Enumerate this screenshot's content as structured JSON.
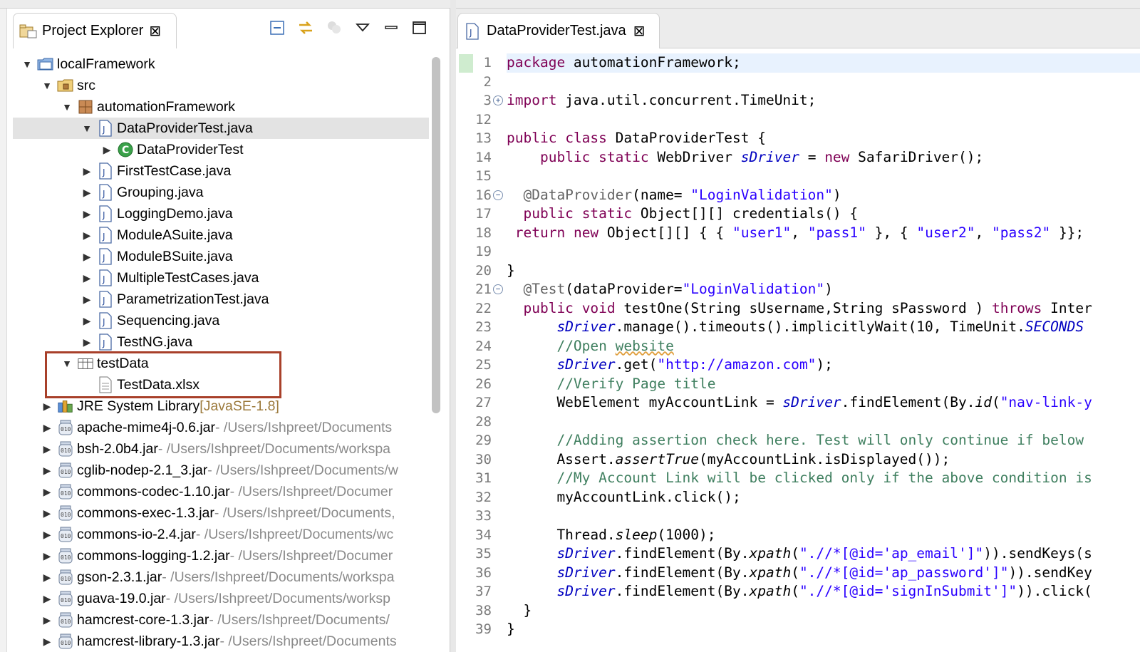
{
  "explorer": {
    "title": "Project Explorer",
    "close_glyph": "⊠",
    "tree": [
      {
        "label": "localFramework",
        "icon": "project-folder-icon",
        "level": 0,
        "expanded": true
      },
      {
        "label": "src",
        "icon": "source-folder-icon",
        "level": 1,
        "expanded": true
      },
      {
        "label": "automationFramework",
        "icon": "package-icon",
        "level": 2,
        "expanded": true
      },
      {
        "label": "DataProviderTest.java",
        "icon": "java-file-icon",
        "level": 3,
        "expanded": true,
        "selected": true
      },
      {
        "label": "DataProviderTest",
        "icon": "class-icon",
        "level": 4,
        "expanded": false
      },
      {
        "label": "FirstTestCase.java",
        "icon": "java-file-icon",
        "level": 3,
        "expanded": false
      },
      {
        "label": "Grouping.java",
        "icon": "java-file-icon",
        "level": 3,
        "expanded": false
      },
      {
        "label": "LoggingDemo.java",
        "icon": "java-file-icon",
        "level": 3,
        "expanded": false
      },
      {
        "label": "ModuleASuite.java",
        "icon": "java-file-icon",
        "level": 3,
        "expanded": false
      },
      {
        "label": "ModuleBSuite.java",
        "icon": "java-file-icon",
        "level": 3,
        "expanded": false
      },
      {
        "label": "MultipleTestCases.java",
        "icon": "java-file-icon",
        "level": 3,
        "expanded": false
      },
      {
        "label": "ParametrizationTest.java",
        "icon": "java-file-icon",
        "level": 3,
        "expanded": false
      },
      {
        "label": "Sequencing.java",
        "icon": "java-file-icon",
        "level": 3,
        "expanded": false
      },
      {
        "label": "TestNG.java",
        "icon": "java-file-icon",
        "level": 3,
        "expanded": false
      },
      {
        "label": "testData",
        "icon": "folder-icon",
        "level": 2,
        "expanded": true
      },
      {
        "label": "TestData.xlsx",
        "icon": "file-icon",
        "level": 3,
        "leaf": true
      },
      {
        "label": "JRE System Library",
        "tag": "[JavaSE-1.8]",
        "icon": "library-icon",
        "level": 1,
        "expanded": false
      },
      {
        "label": "apache-mime4j-0.6.jar",
        "path": " - /Users/Ishpreet/Documents",
        "icon": "jar-icon",
        "level": 1,
        "expanded": false
      },
      {
        "label": "bsh-2.0b4.jar",
        "path": " - /Users/Ishpreet/Documents/workspa",
        "icon": "jar-icon",
        "level": 1,
        "expanded": false
      },
      {
        "label": "cglib-nodep-2.1_3.jar",
        "path": " - /Users/Ishpreet/Documents/w",
        "icon": "jar-icon",
        "level": 1,
        "expanded": false
      },
      {
        "label": "commons-codec-1.10.jar",
        "path": " - /Users/Ishpreet/Documer",
        "icon": "jar-icon",
        "level": 1,
        "expanded": false
      },
      {
        "label": "commons-exec-1.3.jar",
        "path": " - /Users/Ishpreet/Documents,",
        "icon": "jar-icon",
        "level": 1,
        "expanded": false
      },
      {
        "label": "commons-io-2.4.jar",
        "path": " - /Users/Ishpreet/Documents/wc",
        "icon": "jar-icon",
        "level": 1,
        "expanded": false
      },
      {
        "label": "commons-logging-1.2.jar",
        "path": " - /Users/Ishpreet/Documer",
        "icon": "jar-icon",
        "level": 1,
        "expanded": false
      },
      {
        "label": "gson-2.3.1.jar",
        "path": " - /Users/Ishpreet/Documents/workspa",
        "icon": "jar-icon",
        "level": 1,
        "expanded": false
      },
      {
        "label": "guava-19.0.jar",
        "path": " - /Users/Ishpreet/Documents/worksp",
        "icon": "jar-icon",
        "level": 1,
        "expanded": false
      },
      {
        "label": "hamcrest-core-1.3.jar",
        "path": " - /Users/Ishpreet/Documents/",
        "icon": "jar-icon",
        "level": 1,
        "expanded": false
      },
      {
        "label": "hamcrest-library-1.3.jar",
        "path": " - /Users/Ishpreet/Documents",
        "icon": "jar-icon",
        "level": 1,
        "expanded": false
      }
    ]
  },
  "editor": {
    "tab_title": "DataProviderTest.java",
    "close_glyph": "⊠",
    "lines": [
      {
        "n": "1",
        "fold": "",
        "current": true,
        "tokens": [
          [
            "kw",
            "package"
          ],
          [
            "",
            " automationFramework;"
          ]
        ]
      },
      {
        "n": "2",
        "fold": "",
        "tokens": []
      },
      {
        "n": "3",
        "fold": "+",
        "tokens": [
          [
            "kw",
            "import"
          ],
          [
            "",
            " java.util.concurrent.TimeUnit;"
          ]
        ]
      },
      {
        "n": "12",
        "fold": "",
        "tokens": []
      },
      {
        "n": "13",
        "fold": "",
        "tokens": [
          [
            "kw",
            "public"
          ],
          [
            "",
            " "
          ],
          [
            "kw",
            "class"
          ],
          [
            "",
            " DataProviderTest {"
          ]
        ]
      },
      {
        "n": "14",
        "fold": "",
        "tokens": [
          [
            "",
            "    "
          ],
          [
            "kw",
            "public"
          ],
          [
            "",
            " "
          ],
          [
            "kw",
            "static"
          ],
          [
            "",
            " WebDriver "
          ],
          [
            "fld",
            "sDriver"
          ],
          [
            "",
            " = "
          ],
          [
            "kw",
            "new"
          ],
          [
            "",
            " SafariDriver();"
          ]
        ]
      },
      {
        "n": "15",
        "fold": "",
        "tokens": []
      },
      {
        "n": "16",
        "fold": "−",
        "tokens": [
          [
            "",
            "  "
          ],
          [
            "ann",
            "@DataProvider"
          ],
          [
            "",
            "(name= "
          ],
          [
            "st",
            "\"LoginValidation\""
          ],
          [
            "",
            ")"
          ]
        ]
      },
      {
        "n": "17",
        "fold": "",
        "tokens": [
          [
            "",
            "  "
          ],
          [
            "kw",
            "public"
          ],
          [
            "",
            " "
          ],
          [
            "kw",
            "static"
          ],
          [
            "",
            " Object[][] credentials() {"
          ]
        ]
      },
      {
        "n": "18",
        "fold": "",
        "tokens": [
          [
            "",
            " "
          ],
          [
            "kw",
            "return"
          ],
          [
            "",
            " "
          ],
          [
            "kw",
            "new"
          ],
          [
            "",
            " Object[][] { { "
          ],
          [
            "st",
            "\"user1\""
          ],
          [
            "",
            ", "
          ],
          [
            "st",
            "\"pass1\""
          ],
          [
            "",
            " }, { "
          ],
          [
            "st",
            "\"user2\""
          ],
          [
            "",
            ", "
          ],
          [
            "st",
            "\"pass2\""
          ],
          [
            "",
            " }};"
          ]
        ]
      },
      {
        "n": "19",
        "fold": "",
        "tokens": []
      },
      {
        "n": "20",
        "fold": "",
        "tokens": [
          [
            "",
            "}"
          ]
        ]
      },
      {
        "n": "21",
        "fold": "−",
        "tokens": [
          [
            "",
            "  "
          ],
          [
            "ann",
            "@Test"
          ],
          [
            "",
            "(dataProvider="
          ],
          [
            "st",
            "\"LoginValidation\""
          ],
          [
            "",
            ")"
          ]
        ]
      },
      {
        "n": "22",
        "fold": "",
        "tokens": [
          [
            "",
            "  "
          ],
          [
            "kw",
            "public"
          ],
          [
            "",
            " "
          ],
          [
            "kw",
            "void"
          ],
          [
            "",
            " testOne(String sUsername,String sPassword ) "
          ],
          [
            "kw",
            "throws"
          ],
          [
            "",
            " Inter"
          ]
        ]
      },
      {
        "n": "23",
        "fold": "",
        "tokens": [
          [
            "",
            "      "
          ],
          [
            "fld",
            "sDriver"
          ],
          [
            "",
            ".manage().timeouts().implicitlyWait(10, TimeUnit."
          ],
          [
            "fld",
            "SECONDS"
          ]
        ]
      },
      {
        "n": "24",
        "fold": "",
        "tokens": [
          [
            "",
            "      "
          ],
          [
            "cm",
            "//Open "
          ],
          [
            "cmsq",
            "website"
          ]
        ]
      },
      {
        "n": "25",
        "fold": "",
        "tokens": [
          [
            "",
            "      "
          ],
          [
            "fld",
            "sDriver"
          ],
          [
            "",
            ".get("
          ],
          [
            "st",
            "\"http://amazon.com\""
          ],
          [
            "",
            ");"
          ]
        ]
      },
      {
        "n": "26",
        "fold": "",
        "tokens": [
          [
            "",
            "      "
          ],
          [
            "cm",
            "//Verify Page title"
          ]
        ]
      },
      {
        "n": "27",
        "fold": "",
        "tokens": [
          [
            "",
            "      WebElement myAccountLink = "
          ],
          [
            "fld",
            "sDriver"
          ],
          [
            "",
            ".findElement(By."
          ],
          [
            "it",
            "id"
          ],
          [
            "",
            "("
          ],
          [
            "st",
            "\"nav-link-y"
          ]
        ]
      },
      {
        "n": "28",
        "fold": "",
        "tokens": []
      },
      {
        "n": "29",
        "fold": "",
        "tokens": [
          [
            "",
            "      "
          ],
          [
            "cm",
            "//Adding assertion check here. Test will only continue if below"
          ]
        ]
      },
      {
        "n": "30",
        "fold": "",
        "tokens": [
          [
            "",
            "      Assert."
          ],
          [
            "it",
            "assertTrue"
          ],
          [
            "",
            "(myAccountLink.isDisplayed());"
          ]
        ]
      },
      {
        "n": "31",
        "fold": "",
        "tokens": [
          [
            "",
            "      "
          ],
          [
            "cm",
            "//My Account Link will be clicked only if the above condition is"
          ]
        ]
      },
      {
        "n": "32",
        "fold": "",
        "tokens": [
          [
            "",
            "      myAccountLink.click();"
          ]
        ]
      },
      {
        "n": "33",
        "fold": "",
        "tokens": []
      },
      {
        "n": "34",
        "fold": "",
        "tokens": [
          [
            "",
            "      Thread."
          ],
          [
            "it",
            "sleep"
          ],
          [
            "",
            "(1000);"
          ]
        ]
      },
      {
        "n": "35",
        "fold": "",
        "tokens": [
          [
            "",
            "      "
          ],
          [
            "fld",
            "sDriver"
          ],
          [
            "",
            ".findElement(By."
          ],
          [
            "it",
            "xpath"
          ],
          [
            "",
            "("
          ],
          [
            "st",
            "\".//*[@id='ap_email']\""
          ],
          [
            "",
            "))."
          ],
          [
            "",
            "sendKeys(s"
          ]
        ]
      },
      {
        "n": "36",
        "fold": "",
        "tokens": [
          [
            "",
            "      "
          ],
          [
            "fld",
            "sDriver"
          ],
          [
            "",
            ".findElement(By."
          ],
          [
            "it",
            "xpath"
          ],
          [
            "",
            "("
          ],
          [
            "st",
            "\".//*[@id='ap_password']\""
          ],
          [
            "",
            "))."
          ],
          [
            "",
            "sendKey"
          ]
        ]
      },
      {
        "n": "37",
        "fold": "",
        "tokens": [
          [
            "",
            "      "
          ],
          [
            "fld",
            "sDriver"
          ],
          [
            "",
            ".findElement(By."
          ],
          [
            "it",
            "xpath"
          ],
          [
            "",
            "("
          ],
          [
            "st",
            "\".//*[@id='signInSubmit']\""
          ],
          [
            "",
            ")).click("
          ]
        ]
      },
      {
        "n": "38",
        "fold": "",
        "tokens": [
          [
            "",
            "  }"
          ]
        ]
      },
      {
        "n": "39",
        "fold": "",
        "tokens": [
          [
            "",
            "}"
          ]
        ]
      }
    ]
  },
  "colors": {
    "keyword": "#7f0055",
    "string": "#2a00ff",
    "comment": "#3f7f5f",
    "field": "#0000c0",
    "highlight_box": "#a8402a",
    "selection": "#e3e3e3"
  }
}
